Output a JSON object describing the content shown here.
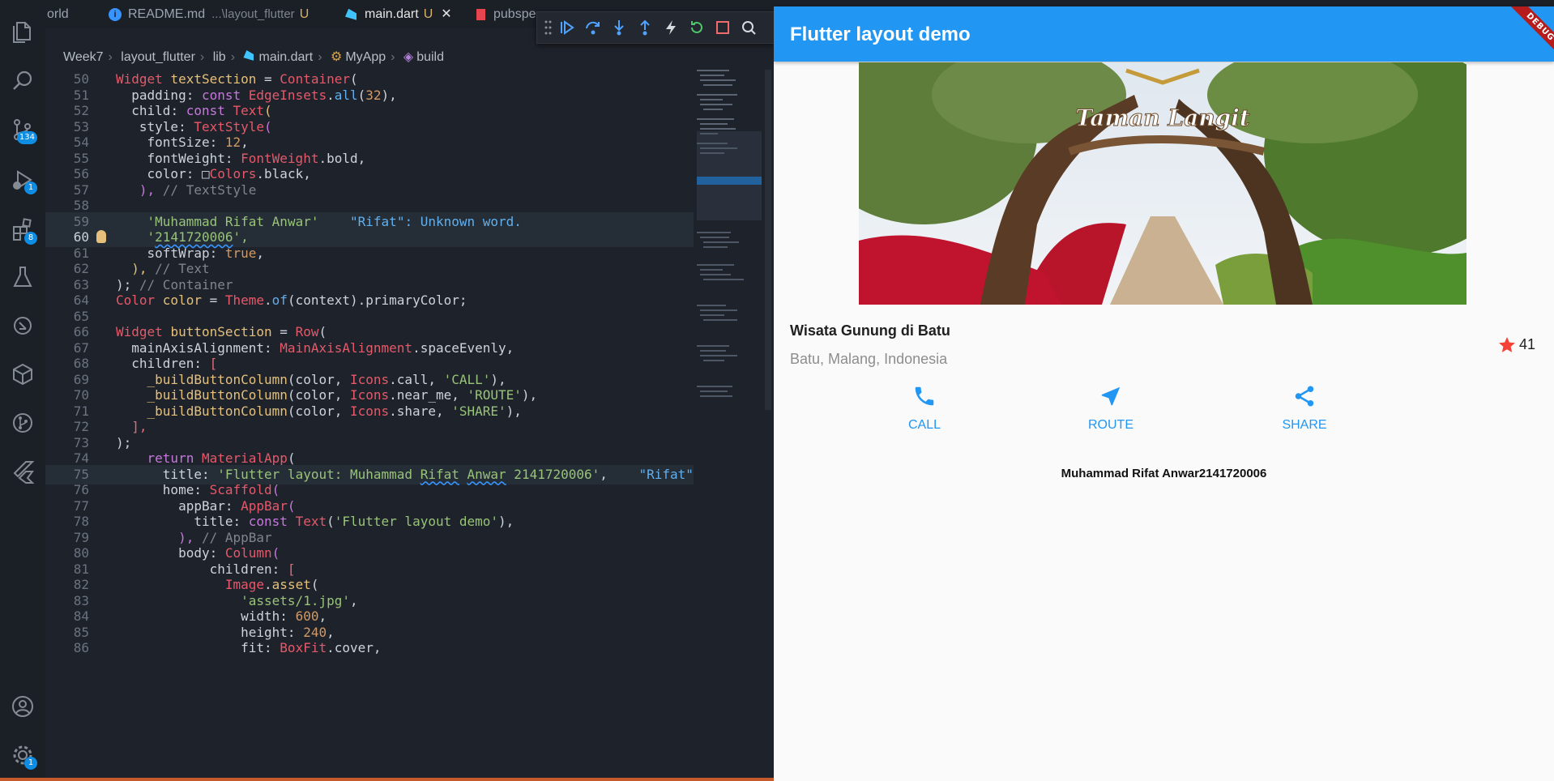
{
  "vscode": {
    "tabs": [
      {
        "label": "orld"
      },
      {
        "label": "README.md",
        "path": "...\\layout_flutter",
        "status": "U"
      },
      {
        "label": "main.dart",
        "status": "U"
      },
      {
        "label": "pubspe"
      }
    ],
    "breadcrumb": [
      "Week7",
      "layout_flutter",
      "lib",
      "main.dart",
      "MyApp",
      "build"
    ],
    "badges": {
      "source_control": "134",
      "run_debug": "1",
      "extensions": "8",
      "settings": "1"
    },
    "code": [
      {
        "n": "50",
        "t": [
          [
            "Widget ",
            "t"
          ],
          [
            "textSection ",
            "y"
          ],
          [
            "= ",
            "x"
          ],
          [
            "Container",
            "t"
          ],
          [
            "(",
            "x"
          ]
        ]
      },
      {
        "n": "51",
        "t": [
          [
            "  padding",
            "x"
          ],
          [
            ": ",
            "x"
          ],
          [
            "const ",
            "k"
          ],
          [
            "EdgeInsets",
            "t"
          ],
          [
            ".",
            "x"
          ],
          [
            "all",
            "f"
          ],
          [
            "(",
            "x"
          ],
          [
            "32",
            "n"
          ],
          [
            "),",
            "x"
          ]
        ]
      },
      {
        "n": "52",
        "t": [
          [
            "  child",
            "x"
          ],
          [
            ": ",
            "x"
          ],
          [
            "const ",
            "k"
          ],
          [
            "Text",
            "t"
          ],
          [
            "(",
            "y"
          ]
        ]
      },
      {
        "n": "53",
        "t": [
          [
            "   style",
            "x"
          ],
          [
            ": ",
            "x"
          ],
          [
            "TextStyle",
            "t"
          ],
          [
            "(",
            "k"
          ]
        ]
      },
      {
        "n": "54",
        "t": [
          [
            "    fontSize",
            "x"
          ],
          [
            ": ",
            "x"
          ],
          [
            "12",
            "n"
          ],
          [
            ",",
            "x"
          ]
        ]
      },
      {
        "n": "55",
        "t": [
          [
            "    fontWeight",
            "x"
          ],
          [
            ": ",
            "x"
          ],
          [
            "FontWeight",
            "t"
          ],
          [
            ".bold,",
            "x"
          ]
        ]
      },
      {
        "n": "56",
        "t": [
          [
            "    color",
            "x"
          ],
          [
            ": ",
            "x"
          ],
          [
            "□",
            "x"
          ],
          [
            "Colors",
            "t"
          ],
          [
            ".black,",
            "x"
          ]
        ]
      },
      {
        "n": "57",
        "t": [
          [
            "   ), ",
            "k"
          ],
          [
            "// TextStyle",
            "c"
          ]
        ]
      },
      {
        "n": "58",
        "t": []
      },
      {
        "n": "59",
        "hl": true,
        "t": [
          [
            "    'Muhammad ",
            "s"
          ],
          [
            "Rifat",
            "sq"
          ],
          [
            " ",
            "s"
          ],
          [
            "Anwar",
            "sq"
          ],
          [
            "'",
            "s"
          ],
          [
            "    \"Rifat\": Unknown word.",
            "f"
          ]
        ]
      },
      {
        "n": "60",
        "hl": true,
        "cur": true,
        "t": [
          [
            "    '",
            "s"
          ],
          [
            "2141720006",
            "sq"
          ],
          [
            "',",
            "s"
          ]
        ]
      },
      {
        "n": "61",
        "t": [
          [
            "    softWrap",
            "x"
          ],
          [
            ": ",
            "x"
          ],
          [
            "true",
            "n"
          ],
          [
            ",",
            "x"
          ]
        ]
      },
      {
        "n": "62",
        "t": [
          [
            "  ), ",
            "y"
          ],
          [
            "// Text",
            "c"
          ]
        ]
      },
      {
        "n": "63",
        "t": [
          [
            "); ",
            "x"
          ],
          [
            "// Container",
            "c"
          ]
        ]
      },
      {
        "n": "64",
        "t": [
          [
            "Color ",
            "t"
          ],
          [
            "color ",
            "y"
          ],
          [
            "= ",
            "x"
          ],
          [
            "Theme",
            "t"
          ],
          [
            ".",
            "x"
          ],
          [
            "of",
            "f"
          ],
          [
            "(context).primaryColor;",
            "x"
          ]
        ]
      },
      {
        "n": "65",
        "t": []
      },
      {
        "n": "66",
        "t": [
          [
            "Widget ",
            "t"
          ],
          [
            "buttonSection ",
            "y"
          ],
          [
            "= ",
            "x"
          ],
          [
            "Row",
            "t"
          ],
          [
            "(",
            "x"
          ]
        ]
      },
      {
        "n": "67",
        "t": [
          [
            "  mainAxisAlignment",
            "x"
          ],
          [
            ": ",
            "x"
          ],
          [
            "MainAxisAlignment",
            "t"
          ],
          [
            ".spaceEvenly,",
            "x"
          ]
        ]
      },
      {
        "n": "68",
        "t": [
          [
            "  children",
            "x"
          ],
          [
            ": ",
            "x"
          ],
          [
            "[",
            "p"
          ]
        ]
      },
      {
        "n": "69",
        "t": [
          [
            "    _buildButtonColumn",
            "y"
          ],
          [
            "(color, ",
            "x"
          ],
          [
            "Icons",
            "t"
          ],
          [
            ".call, ",
            "x"
          ],
          [
            "'CALL'",
            "s"
          ],
          [
            "),",
            "x"
          ]
        ]
      },
      {
        "n": "70",
        "t": [
          [
            "    _buildButtonColumn",
            "y"
          ],
          [
            "(color, ",
            "x"
          ],
          [
            "Icons",
            "t"
          ],
          [
            ".near_me, ",
            "x"
          ],
          [
            "'ROUTE'",
            "s"
          ],
          [
            "),",
            "x"
          ]
        ]
      },
      {
        "n": "71",
        "t": [
          [
            "    _buildButtonColumn",
            "y"
          ],
          [
            "(color, ",
            "x"
          ],
          [
            "Icons",
            "t"
          ],
          [
            ".share, ",
            "x"
          ],
          [
            "'SHARE'",
            "s"
          ],
          [
            "),",
            "x"
          ]
        ]
      },
      {
        "n": "72",
        "t": [
          [
            "  ],",
            "p"
          ]
        ]
      },
      {
        "n": "73",
        "t": [
          [
            ");",
            "x"
          ]
        ]
      },
      {
        "n": "74",
        "t": [
          [
            "    return ",
            "k"
          ],
          [
            "MaterialApp",
            "t"
          ],
          [
            "(",
            "x"
          ]
        ]
      },
      {
        "n": "75",
        "hl": true,
        "t": [
          [
            "      title",
            "x"
          ],
          [
            ": ",
            "x"
          ],
          [
            "'Flutter layout: Muhammad ",
            "s"
          ],
          [
            "Rifat",
            "sq"
          ],
          [
            " ",
            "s"
          ],
          [
            "Anwar",
            "sq"
          ],
          [
            " 2141720006'",
            "s"
          ],
          [
            ",    ",
            "x"
          ],
          [
            "\"Rifat\"",
            "f"
          ]
        ]
      },
      {
        "n": "76",
        "t": [
          [
            "      home",
            "x"
          ],
          [
            ": ",
            "x"
          ],
          [
            "Scaffold",
            "t"
          ],
          [
            "(",
            "k"
          ]
        ]
      },
      {
        "n": "77",
        "t": [
          [
            "        appBar",
            "x"
          ],
          [
            ": ",
            "x"
          ],
          [
            "AppBar",
            "t"
          ],
          [
            "(",
            "k"
          ]
        ]
      },
      {
        "n": "78",
        "t": [
          [
            "          title",
            "x"
          ],
          [
            ": ",
            "x"
          ],
          [
            "const ",
            "k"
          ],
          [
            "Text",
            "t"
          ],
          [
            "(",
            "x"
          ],
          [
            "'Flutter layout demo'",
            "s"
          ],
          [
            "),",
            "x"
          ]
        ]
      },
      {
        "n": "79",
        "t": [
          [
            "        ), ",
            "k"
          ],
          [
            "// AppBar",
            "c"
          ]
        ]
      },
      {
        "n": "80",
        "t": [
          [
            "        body",
            "x"
          ],
          [
            ": ",
            "x"
          ],
          [
            "Column",
            "t"
          ],
          [
            "(",
            "k"
          ]
        ]
      },
      {
        "n": "81",
        "t": [
          [
            "            children",
            "x"
          ],
          [
            ": ",
            "x"
          ],
          [
            "[",
            "p"
          ]
        ]
      },
      {
        "n": "82",
        "t": [
          [
            "              Image",
            "t"
          ],
          [
            ".",
            "x"
          ],
          [
            "asset",
            "y"
          ],
          [
            "(",
            "x"
          ]
        ]
      },
      {
        "n": "83",
        "t": [
          [
            "                'assets/1.jpg'",
            "s"
          ],
          [
            ",",
            "x"
          ]
        ]
      },
      {
        "n": "84",
        "t": [
          [
            "                width",
            "x"
          ],
          [
            ": ",
            "x"
          ],
          [
            "600",
            "n"
          ],
          [
            ",",
            "x"
          ]
        ]
      },
      {
        "n": "85",
        "t": [
          [
            "                height",
            "x"
          ],
          [
            ": ",
            "x"
          ],
          [
            "240",
            "n"
          ],
          [
            ",",
            "x"
          ]
        ]
      },
      {
        "n": "86",
        "t": [
          [
            "                fit",
            "x"
          ],
          [
            ": ",
            "x"
          ],
          [
            "BoxFit",
            "t"
          ],
          [
            ".cover,",
            "x"
          ]
        ]
      }
    ]
  },
  "app": {
    "appbar_title": "Flutter layout demo",
    "debug_banner": "DEBUG",
    "image_sign": "Taman Langit",
    "title": "Wisata Gunung di Batu",
    "subtitle": "Batu, Malang, Indonesia",
    "favorite_count": "41",
    "buttons": [
      {
        "label": "CALL",
        "icon": "phone-icon"
      },
      {
        "label": "ROUTE",
        "icon": "near-me-icon"
      },
      {
        "label": "SHARE",
        "icon": "share-icon"
      }
    ],
    "text_section": "Muhammad Rifat Anwar2141720006",
    "colors": {
      "primary": "#2196f3",
      "star": "#f44336",
      "banner": "#b71c1c"
    }
  }
}
